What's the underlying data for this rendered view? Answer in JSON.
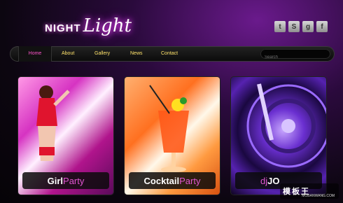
{
  "logo": {
    "part1": "NIGHT",
    "part2": "Light"
  },
  "social": [
    {
      "icon": "twitter-icon",
      "glyph": "t"
    },
    {
      "icon": "skype-icon",
      "glyph": "S"
    },
    {
      "icon": "digg-icon",
      "glyph": "g"
    },
    {
      "icon": "facebook-icon",
      "glyph": "f"
    }
  ],
  "nav": {
    "items": [
      {
        "label": "Home",
        "active": true
      },
      {
        "label": "About"
      },
      {
        "label": "Gallery"
      },
      {
        "label": "News"
      },
      {
        "label": "Contact"
      }
    ],
    "search_placeholder": "Search"
  },
  "cards": [
    {
      "title_a": "Girl",
      "title_b": "Party"
    },
    {
      "title_a": "Cocktail",
      "title_b": "Party"
    },
    {
      "title_a": "dj",
      "title_b": "JO"
    }
  ],
  "watermark": {
    "main": "模板王",
    "sub": "MOBANWANG.COM"
  },
  "colors": {
    "accent": "#e055d0",
    "nav_text": "#ffe36b",
    "active": "#ff55cc"
  }
}
